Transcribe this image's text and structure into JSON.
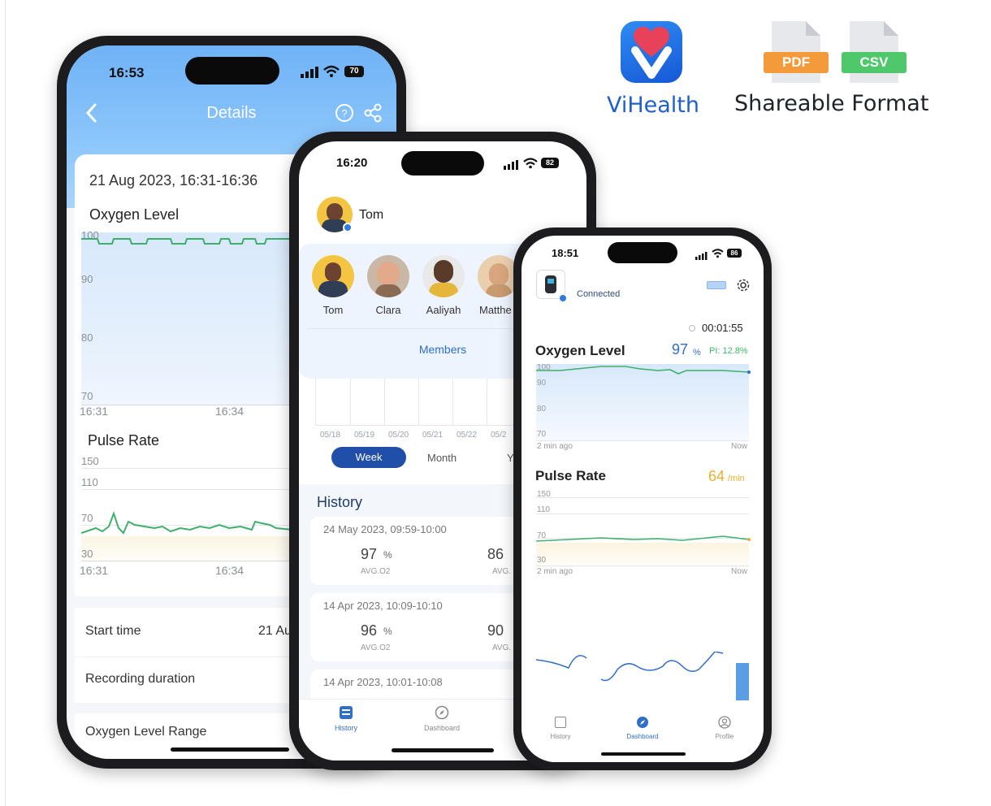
{
  "brand": {
    "app_name": "ViHealth",
    "shareable_label": "Shareable Format",
    "formats": [
      "PDF",
      "CSV"
    ],
    "colors": {
      "pdf": "#f39a3a",
      "csv": "#4fc86c",
      "brand_blue": "#1f5fc9"
    }
  },
  "phone_left": {
    "time": "16:53",
    "battery": "70",
    "header_title": "Details",
    "date_range": "21 Aug 2023, 16:31-16:36",
    "oxygen": {
      "title": "Oxygen Level",
      "y_ticks": [
        "100",
        "90",
        "80",
        "70"
      ],
      "x_ticks": [
        "16:31",
        "16:34"
      ]
    },
    "pulse": {
      "title": "Pulse Rate",
      "y_ticks": [
        "150",
        "110",
        "70",
        "30"
      ],
      "x_ticks": [
        "16:31",
        "16:34"
      ]
    },
    "rows": {
      "start_time_label": "Start time",
      "start_time_value": "21 Au",
      "recording_duration_label": "Recording duration",
      "oxygen_range_label": "Oxygen Level Range"
    }
  },
  "phone_middle": {
    "time": "16:20",
    "battery": "82",
    "user_name": "Tom",
    "members": [
      "Tom",
      "Clara",
      "Aaliyah",
      "Matthe"
    ],
    "members_button": "Members",
    "dates": [
      "05/18",
      "05/19",
      "05/20",
      "05/21",
      "05/22",
      "05/2"
    ],
    "period_tabs": {
      "week": "Week",
      "month": "Month",
      "year": "Y"
    },
    "history_title": "History",
    "history": [
      {
        "date": "24 May 2023, 09:59-10:00",
        "o2": "97",
        "o2_unit": "%",
        "o2_label": "AVG.O2",
        "pr": "86",
        "pr_label": "AVG."
      },
      {
        "date": "14 Apr 2023, 10:09-10:10",
        "o2": "96",
        "o2_unit": "%",
        "o2_label": "AVG.O2",
        "pr": "90",
        "pr_label": "AVG."
      },
      {
        "date": "14 Apr 2023, 10:01-10:08"
      }
    ],
    "nav": {
      "history": "History",
      "dashboard": "Dashboard"
    }
  },
  "phone_right": {
    "time": "18:51",
    "battery": "86",
    "connection": "Connected",
    "timer": "00:01:55",
    "oxygen": {
      "title": "Oxygen Level",
      "value": "97",
      "unit": "%",
      "pi": "PI: 12.8%",
      "y_ticks": [
        "100",
        "90",
        "80",
        "70"
      ],
      "x_start": "2 min ago",
      "x_end": "Now"
    },
    "pulse": {
      "title": "Pulse Rate",
      "value": "64",
      "unit": "/min",
      "y_ticks": [
        "150",
        "110",
        "70",
        "30"
      ],
      "x_start": "2 min ago",
      "x_end": "Now"
    },
    "nav": {
      "history": "History",
      "dashboard": "Dashboard",
      "profile": "Profile"
    },
    "colors": {
      "oxygen": "#2f6ec9",
      "pulse": "#e8b02e",
      "pi": "#3cb96a",
      "line_green": "#3fb06a"
    }
  }
}
